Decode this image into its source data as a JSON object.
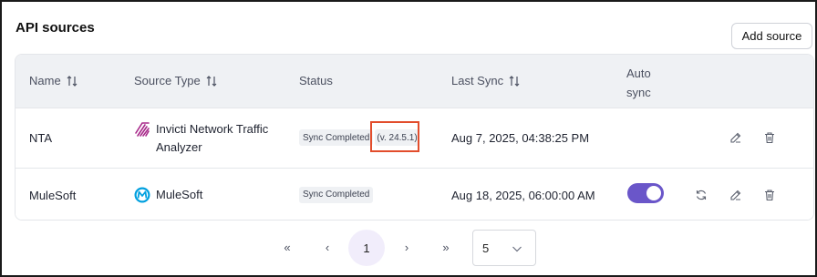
{
  "header": {
    "title": "API sources",
    "add_label": "Add source"
  },
  "columns": {
    "name": "Name",
    "source_type": "Source Type",
    "status": "Status",
    "last_sync": "Last Sync",
    "auto_sync_line1": "Auto",
    "auto_sync_line2": "sync"
  },
  "rows": [
    {
      "name": "NTA",
      "source_line1": "Invicti Network Traffic",
      "source_line2": "Analyzer",
      "source_icon": "invicti-icon",
      "status": "Sync Completed",
      "version": "(v. 24.5.1)",
      "last_sync": "Aug 7, 2025, 04:38:25 PM"
    },
    {
      "name": "MuleSoft",
      "source_line1": "MuleSoft",
      "source_icon": "mulesoft-icon",
      "status": "Sync Completed",
      "last_sync": "Aug 18, 2025, 06:00:00 AM",
      "auto_sync_on": true
    }
  ],
  "pagination": {
    "first": "«",
    "prev": "‹",
    "current": "1",
    "next": "›",
    "last": "»",
    "page_size": "5"
  },
  "colors": {
    "accent": "#6a56c9",
    "highlight": "#e24d2c",
    "header_bg": "#eff1f4"
  }
}
